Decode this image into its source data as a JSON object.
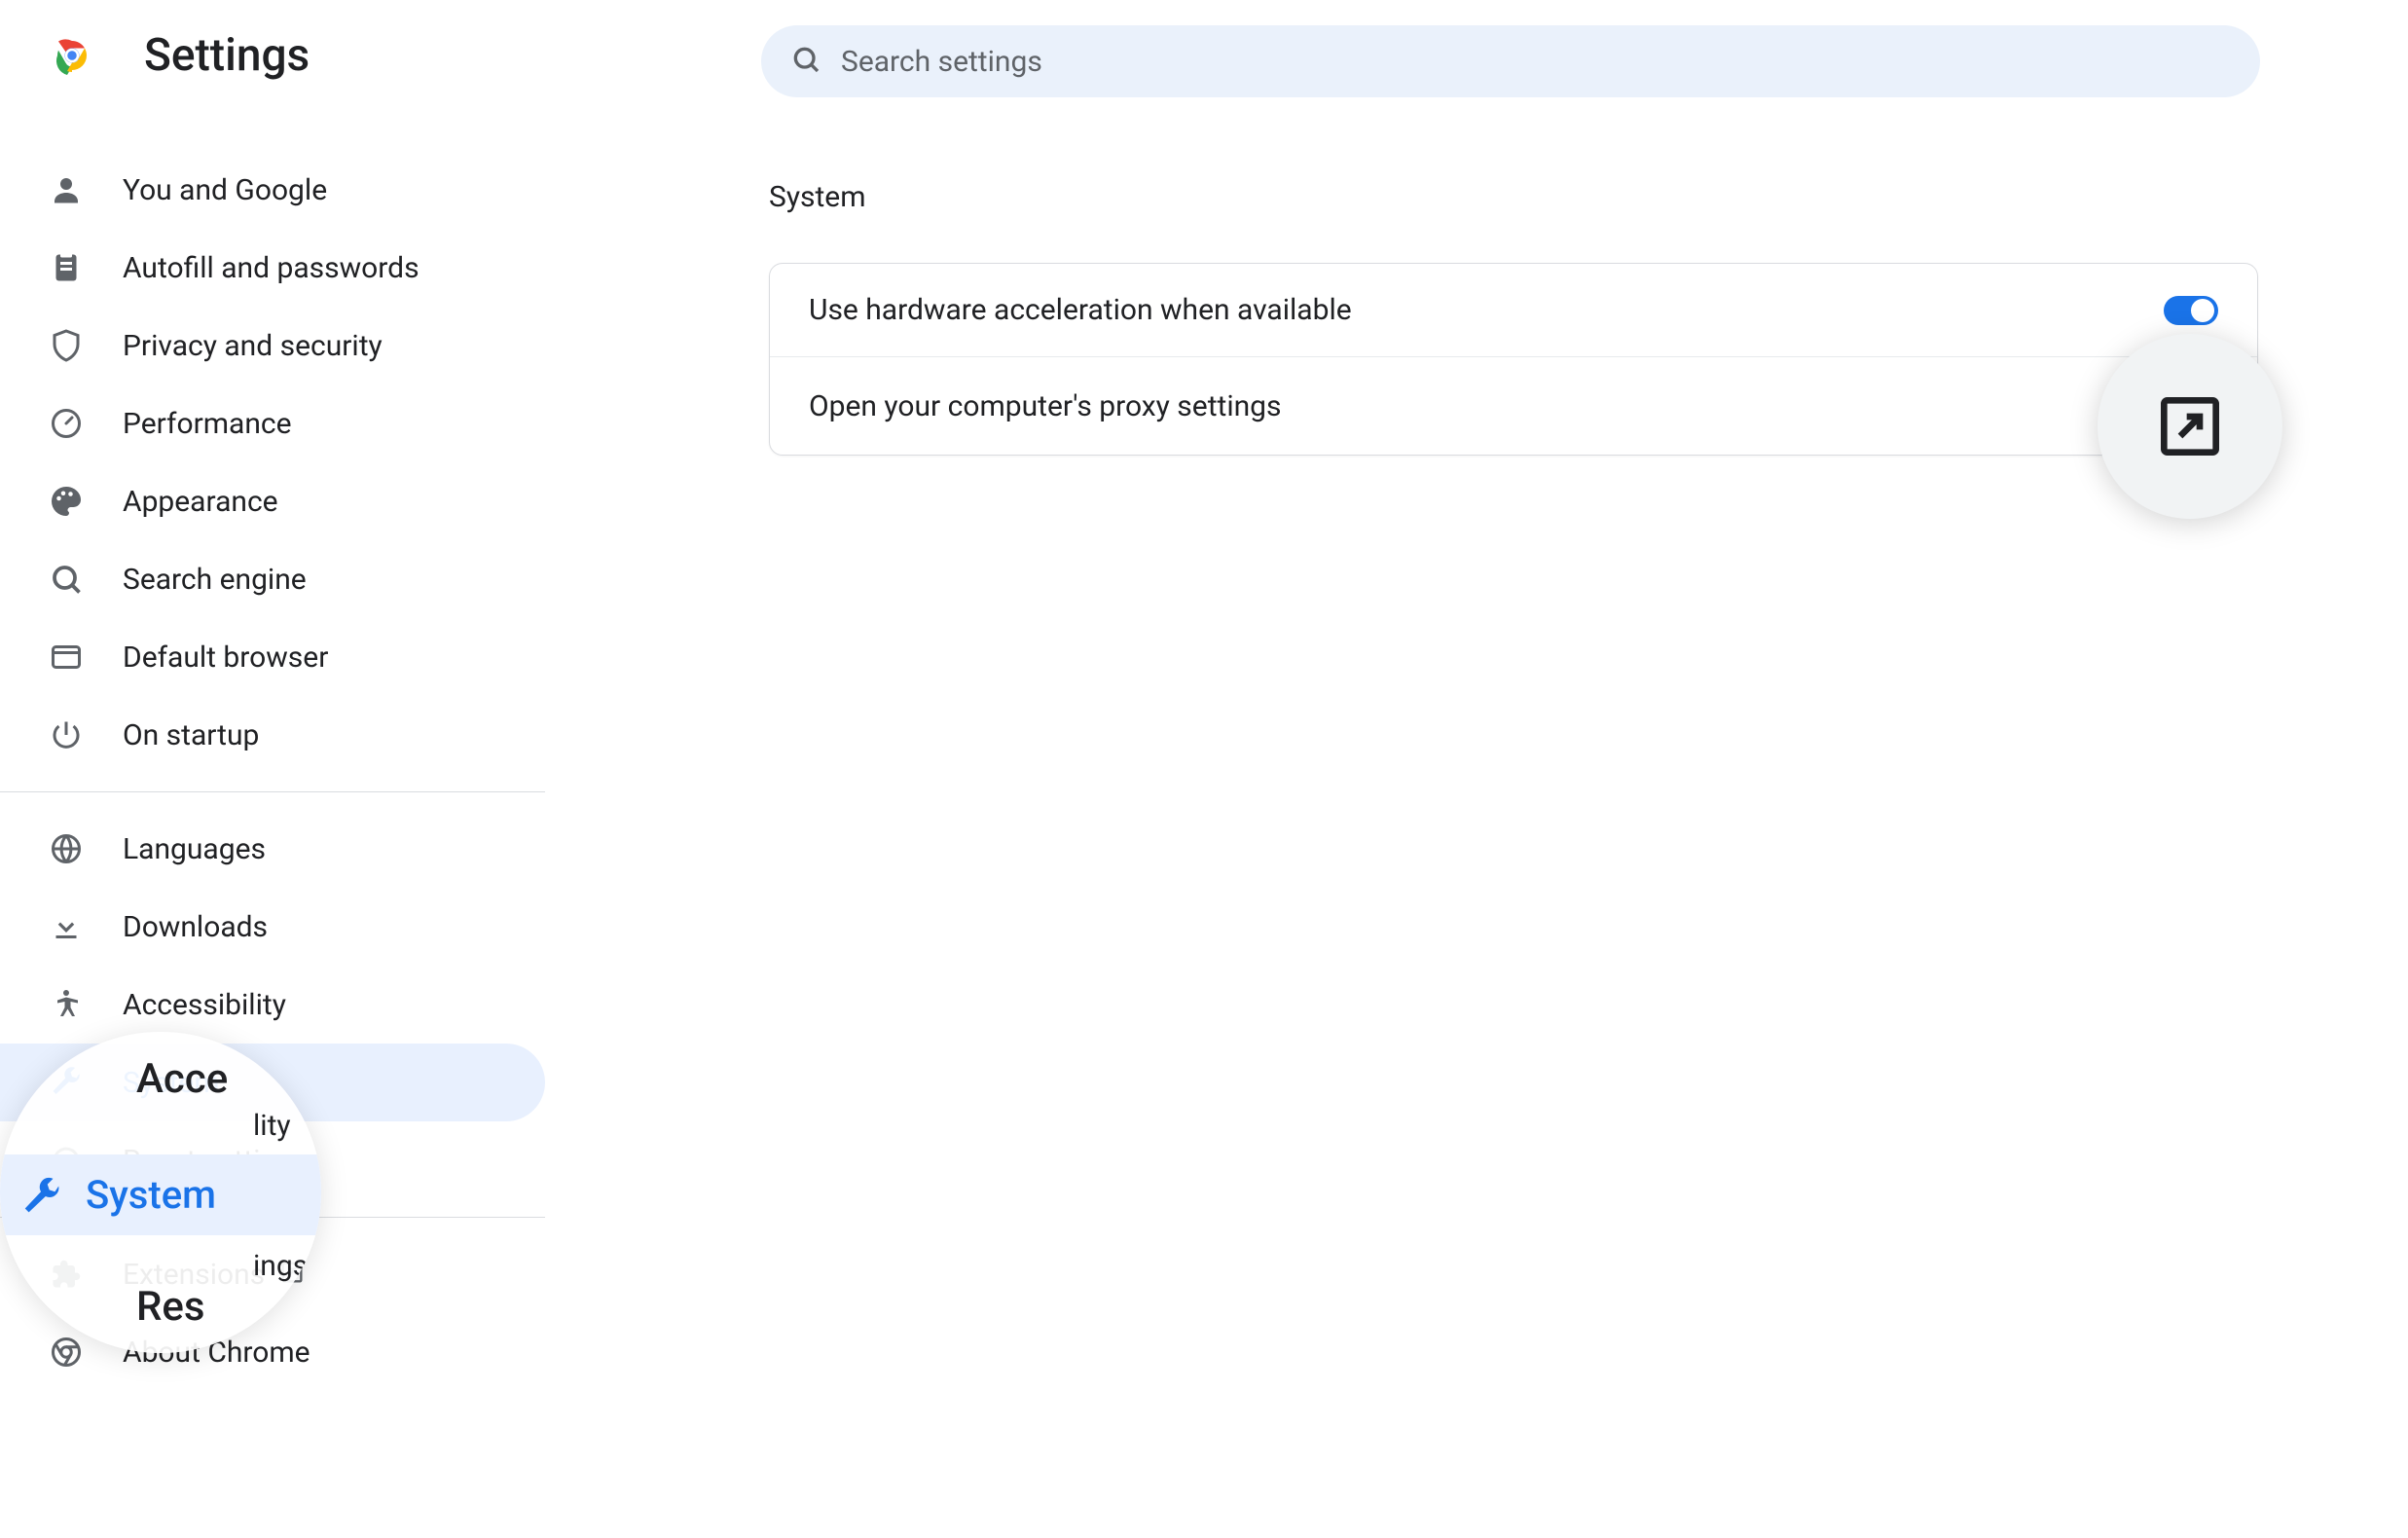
{
  "header": {
    "title": "Settings"
  },
  "search": {
    "placeholder": "Search settings"
  },
  "sidebar": {
    "items": [
      {
        "label": "You and Google",
        "icon": "person"
      },
      {
        "label": "Autofill and passwords",
        "icon": "clipboard"
      },
      {
        "label": "Privacy and security",
        "icon": "shield"
      },
      {
        "label": "Performance",
        "icon": "speedometer"
      },
      {
        "label": "Appearance",
        "icon": "palette"
      },
      {
        "label": "Search engine",
        "icon": "search"
      },
      {
        "label": "Default browser",
        "icon": "browser"
      },
      {
        "label": "On startup",
        "icon": "power"
      }
    ],
    "items2": [
      {
        "label": "Languages",
        "icon": "globe"
      },
      {
        "label": "Downloads",
        "icon": "download"
      },
      {
        "label": "Accessibility",
        "icon": "accessibility"
      },
      {
        "label": "System",
        "icon": "wrench",
        "active": true
      },
      {
        "label": "Reset settings",
        "icon": "reset"
      }
    ],
    "items3": [
      {
        "label": "Extensions",
        "icon": "puzzle",
        "external": true
      },
      {
        "label": "About Chrome",
        "icon": "chrome-outline"
      }
    ]
  },
  "content": {
    "section_title": "System",
    "rows": [
      {
        "label": "Use hardware acceleration when available",
        "control": "toggle",
        "value": true
      },
      {
        "label": "Open your computer's proxy settings",
        "control": "external"
      }
    ]
  },
  "zoom1": {
    "top_partial": "Acce",
    "top_partial2": "lity",
    "active_label": "System",
    "bottom_partial": "Res",
    "bottom_partial2": "ings"
  }
}
